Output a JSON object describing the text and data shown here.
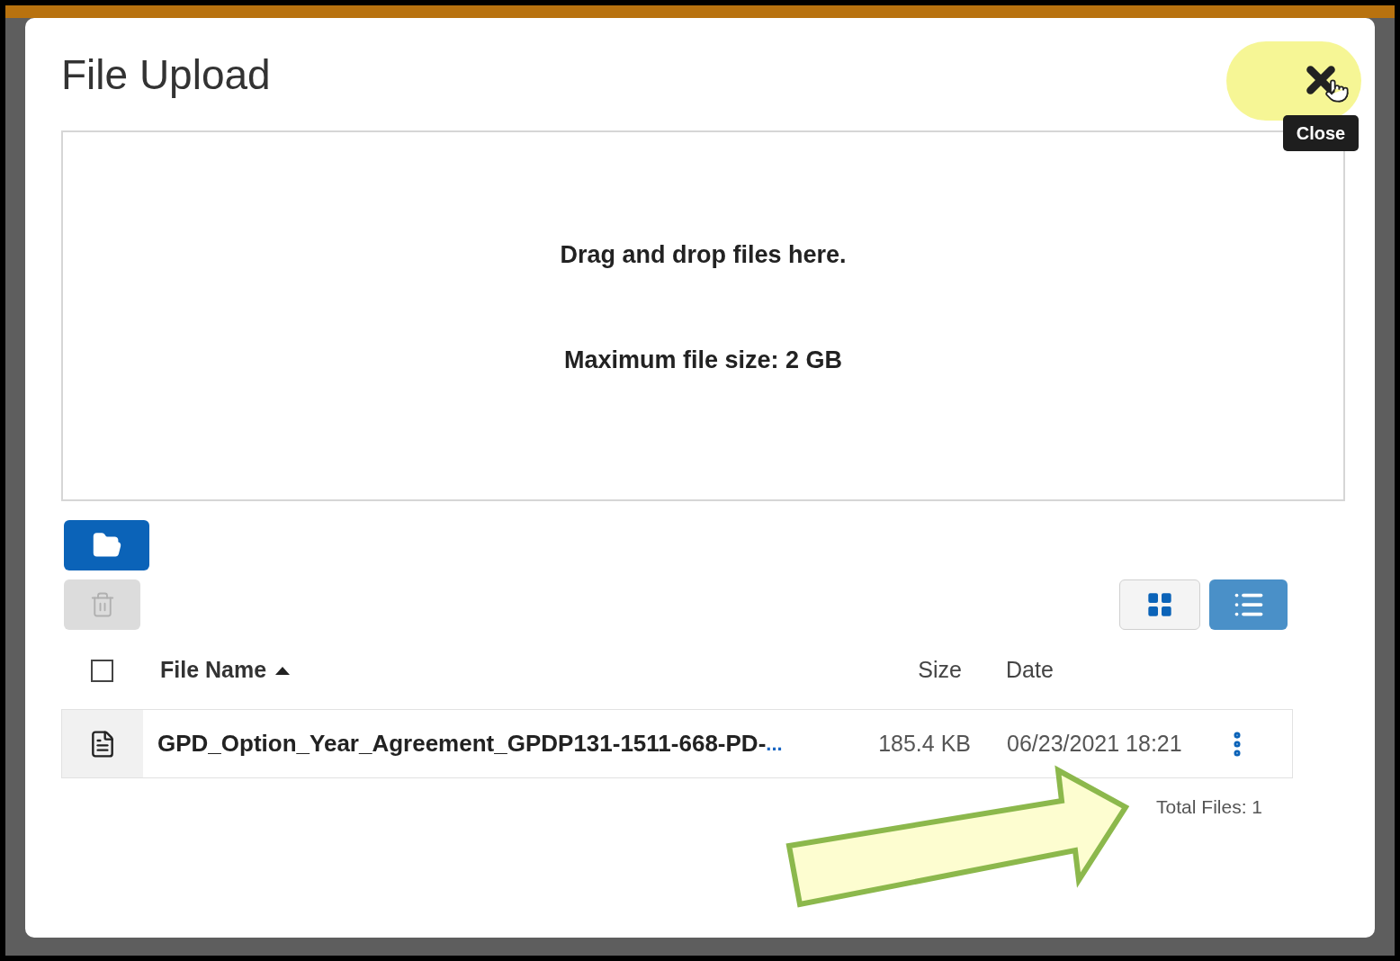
{
  "dialog": {
    "title": "File Upload",
    "close_tooltip": "Close",
    "dropzone": {
      "instruction": "Drag and drop files here.",
      "limit": "Maximum file size: 2 GB"
    },
    "toolbar": {
      "buttons": [
        {
          "kind": "browse",
          "disabled": false
        },
        {
          "kind": "delete",
          "disabled": true
        }
      ],
      "view_modes": [
        {
          "kind": "grid",
          "selected": false
        },
        {
          "kind": "list",
          "selected": true
        }
      ]
    },
    "table": {
      "select_all_checked": false,
      "columns": [
        {
          "label": "File Name",
          "sorted": true
        },
        {
          "label": "Size"
        },
        {
          "label": "Date"
        }
      ],
      "rows": [
        {
          "name": "GPD_Option_Year_Agreement_GPDP131-1511-668-PD-",
          "ellipsis": "...",
          "size": "185.4 KB",
          "date": "06/23/2021 18:21"
        }
      ]
    },
    "total": "Total Files: 1"
  }
}
